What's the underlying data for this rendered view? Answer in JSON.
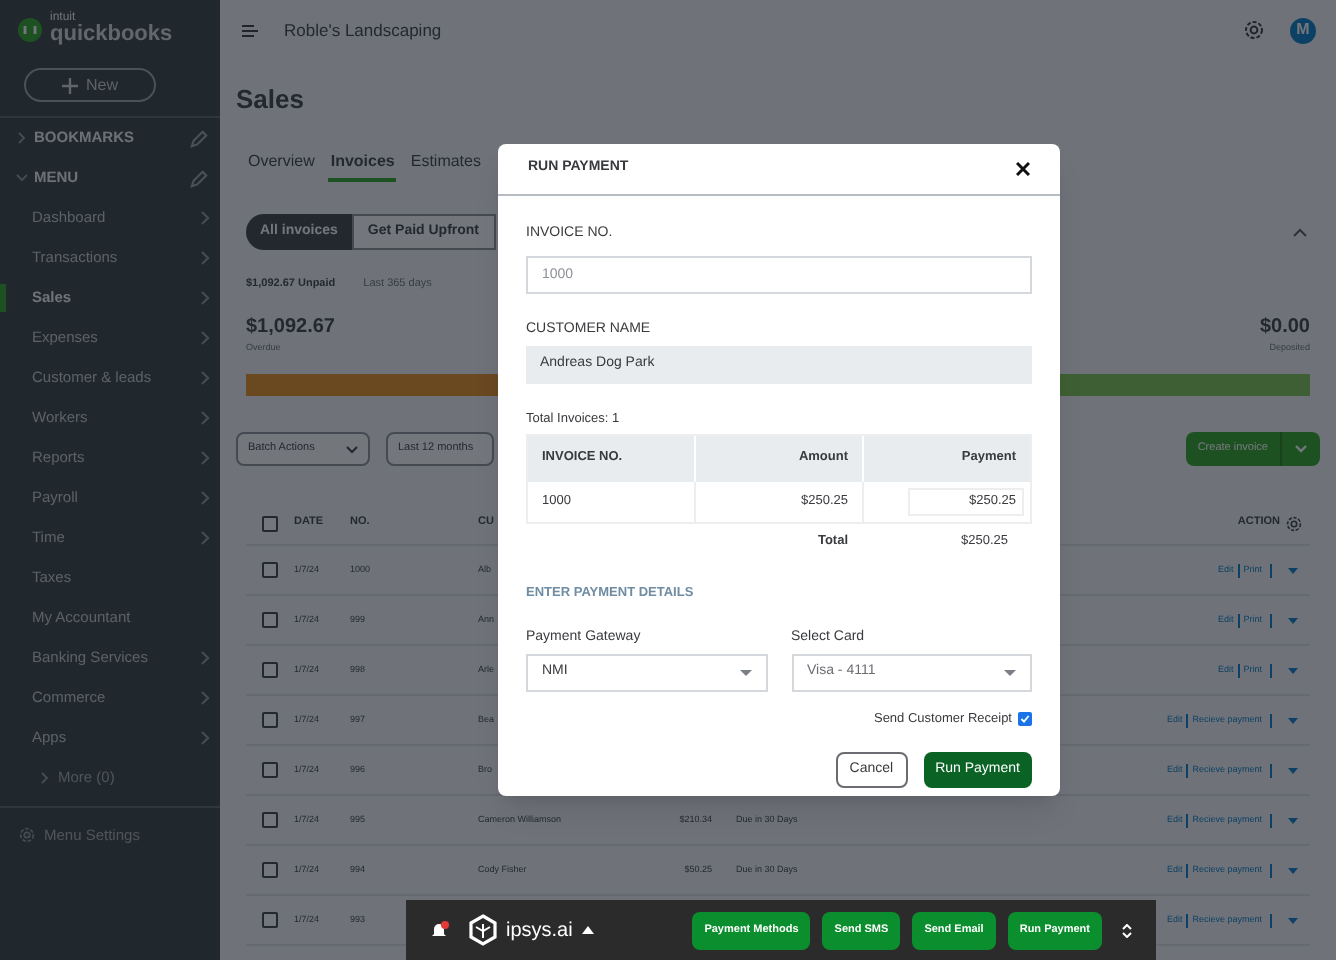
{
  "sidebar": {
    "logo": {
      "brand": "intuit",
      "product": "quickbooks"
    },
    "new_button": "New",
    "sections": [
      {
        "label": "BOOKMARKS",
        "expanded": false
      },
      {
        "label": "MENU",
        "expanded": true
      }
    ],
    "items": [
      {
        "label": "Dashboard",
        "has_submenu": true,
        "selected": false
      },
      {
        "label": "Transactions",
        "has_submenu": true,
        "selected": false
      },
      {
        "label": "Sales",
        "has_submenu": true,
        "selected": true
      },
      {
        "label": "Expenses",
        "has_submenu": true,
        "selected": false
      },
      {
        "label": "Customer & leads",
        "has_submenu": true,
        "selected": false
      },
      {
        "label": "Workers",
        "has_submenu": true,
        "selected": false
      },
      {
        "label": "Reports",
        "has_submenu": true,
        "selected": false
      },
      {
        "label": "Payroll",
        "has_submenu": true,
        "selected": false
      },
      {
        "label": "Time",
        "has_submenu": true,
        "selected": false
      },
      {
        "label": "Taxes",
        "has_submenu": false,
        "selected": false
      },
      {
        "label": "My Accountant",
        "has_submenu": false,
        "selected": false
      },
      {
        "label": "Banking Services",
        "has_submenu": true,
        "selected": false
      },
      {
        "label": "Commerce",
        "has_submenu": true,
        "selected": false
      },
      {
        "label": "Apps",
        "has_submenu": true,
        "selected": false
      }
    ],
    "more": "More (0)",
    "settings": "Menu Settings"
  },
  "header": {
    "company": "Roble's Landscaping",
    "avatar": "M"
  },
  "page": {
    "title": "Sales",
    "tabs": [
      {
        "label": "Overview",
        "selected": false
      },
      {
        "label": "Invoices",
        "selected": true
      },
      {
        "label": "Estimates",
        "selected": false
      }
    ],
    "filters": [
      {
        "label": "All invoices",
        "selected": true
      },
      {
        "label": "Get Paid Upfront",
        "selected": false
      }
    ],
    "summary": {
      "unpaid": "$1,092.67 Unpaid",
      "period": "Last 365 days",
      "overdue_amount": "$1,092.67",
      "overdue_label": "Overdue",
      "deposited_amount": "$0.00",
      "deposited_label": "Deposited"
    },
    "toolbar": {
      "batch": "Batch Actions",
      "range": "Last 12 months",
      "create": "Create invoice"
    },
    "table": {
      "columns": [
        "DATE",
        "NO.",
        "CU",
        "ACTION"
      ],
      "all_checked": false,
      "rows": [
        {
          "checked": false,
          "date": "1/7/24",
          "no": "1000",
          "customer": "Alb",
          "actions": [
            "Edit",
            "Print"
          ]
        },
        {
          "checked": false,
          "date": "1/7/24",
          "no": "999",
          "customer": "Ann",
          "actions": [
            "Edit",
            "Print"
          ]
        },
        {
          "checked": false,
          "date": "1/7/24",
          "no": "998",
          "customer": "Arle",
          "actions": [
            "Edit",
            "Print"
          ]
        },
        {
          "checked": false,
          "date": "1/7/24",
          "no": "997",
          "customer": "Bea",
          "actions": [
            "Edit",
            "Recieve payment"
          ]
        },
        {
          "checked": false,
          "date": "1/7/24",
          "no": "996",
          "customer": "Bro",
          "actions": [
            "Edit",
            "Recieve payment"
          ]
        },
        {
          "checked": false,
          "date": "1/7/24",
          "no": "995",
          "customer": "Cameron Williamson",
          "amount": "$210.34",
          "status": "Due in 30 Days",
          "actions": [
            "Edit",
            "Recieve payment"
          ]
        },
        {
          "checked": false,
          "date": "1/7/24",
          "no": "994",
          "customer": "Cody Fisher",
          "amount": "$50.25",
          "status": "Due in 30 Days",
          "actions": [
            "Edit",
            "Recieve payment"
          ]
        },
        {
          "checked": false,
          "date": "1/7/24",
          "no": "993",
          "actions": [
            "Edit",
            "Recieve payment"
          ]
        }
      ]
    }
  },
  "modal": {
    "title": "RUN PAYMENT",
    "invoice_label": "INVOICE NO.",
    "invoice_placeholder": "1000",
    "customer_label": "CUSTOMER NAME",
    "customer_value": "Andreas Dog Park",
    "total_invoices": "Total Invoices: 1",
    "table": {
      "columns": [
        "INVOICE NO.",
        "Amount",
        "Payment"
      ],
      "rows": [
        {
          "invoice": "1000",
          "amount": "$250.25",
          "payment": "$250.25"
        }
      ],
      "total_label": "Total",
      "total_value": "$250.25"
    },
    "details_heading": "ENTER PAYMENT DETAILS",
    "gateway_label": "Payment Gateway",
    "gateway_value": "NMI",
    "card_label": "Select Card",
    "card_value": "Visa - 4111",
    "receipt_label": "Send Customer Receipt",
    "receipt_checked": true,
    "cancel": "Cancel",
    "run": "Run Payment"
  },
  "bottom_bar": {
    "brand": "ipsys.ai",
    "notification": true,
    "buttons": [
      "Payment Methods",
      "Send SMS",
      "Send Email",
      "Run Payment"
    ]
  }
}
